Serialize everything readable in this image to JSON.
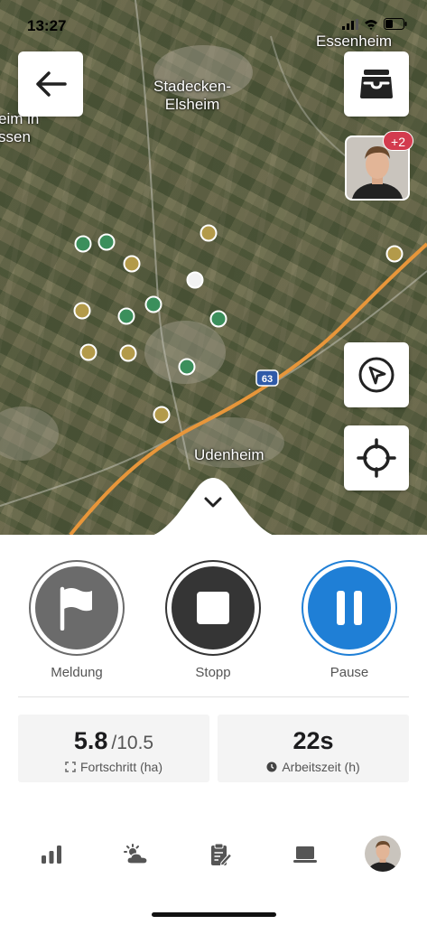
{
  "status_bar": {
    "time": "13:27"
  },
  "map": {
    "places": {
      "essenheim": "Essenheim",
      "stadecken": "Stadecken-\nElsheim",
      "left_town": "eim in\nssen",
      "udenheim": "Udenheim"
    },
    "road_shield": "63",
    "avatar_badge": "+2",
    "colors": {
      "green_marker": "#3b8f5c",
      "yellow_marker": "#b39a4a",
      "road": "#e8963a",
      "white_marker": "#f2f2f2"
    }
  },
  "controls": {
    "report_label": "Meldung",
    "stop_label": "Stopp",
    "pause_label": "Pause",
    "colors": {
      "report": "#6b6b6b",
      "stop": "#353535",
      "pause": "#1f7fd6"
    }
  },
  "stats": {
    "progress_value": "5.8",
    "progress_total": "/10.5",
    "progress_label": "Fortschritt (ha)",
    "worktime_value": "22s",
    "worktime_label": "Arbeitszeit (h)"
  },
  "tabs": {
    "icons": [
      "stats-icon",
      "weather-icon",
      "notes-icon",
      "laptop-icon",
      "profile-avatar"
    ]
  }
}
